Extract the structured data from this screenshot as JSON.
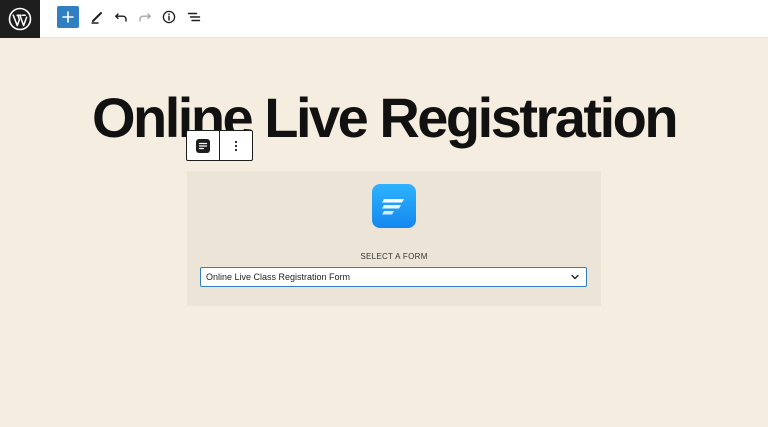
{
  "topbar": {
    "logo_icon": "wordpress-logo-icon",
    "buttons": [
      {
        "name": "add-block-button",
        "icon": "plus-icon"
      },
      {
        "name": "tools-button",
        "icon": "pencil-icon"
      },
      {
        "name": "undo-button",
        "icon": "undo-icon"
      },
      {
        "name": "redo-button",
        "icon": "redo-icon"
      },
      {
        "name": "details-button",
        "icon": "info-icon"
      },
      {
        "name": "list-view-button",
        "icon": "list-view-icon"
      }
    ],
    "accent_color": "#2f7fc1"
  },
  "page": {
    "title": "Online Live Registration",
    "background_color": "#f5eddf"
  },
  "block_toolbar": {
    "block_icon": "fluent-forms-block-icon",
    "options_icon": "more-vertical-icon"
  },
  "form_block": {
    "logo_icon": "fluent-forms-logo-icon",
    "select_label": "SELECT A FORM",
    "selected_form": "Online Live Class Registration Form"
  }
}
